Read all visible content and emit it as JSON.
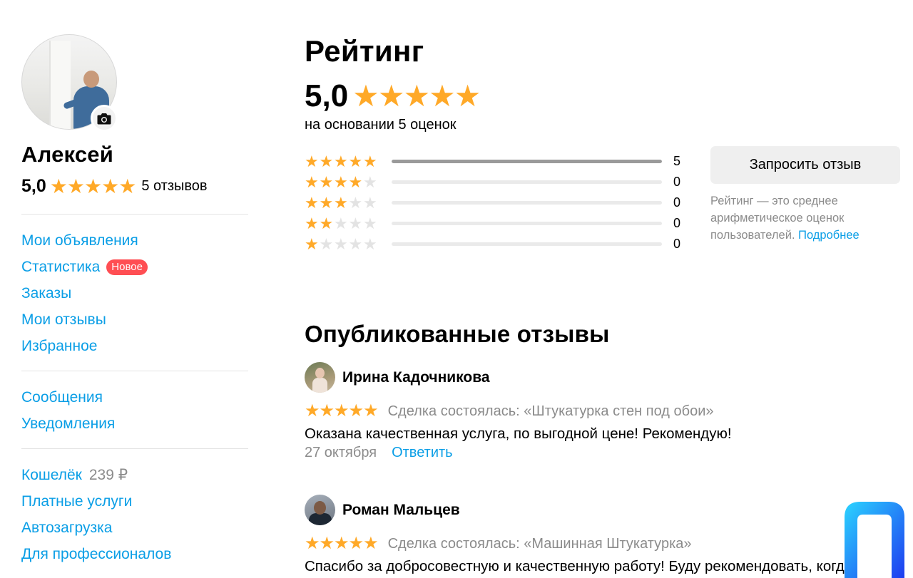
{
  "profile": {
    "name": "Алексей",
    "rating": "5,0",
    "reviews_count": "5 отзывов"
  },
  "sidebar": {
    "group1": [
      {
        "label": "Мои объявления"
      },
      {
        "label": "Статистика",
        "badge": "Новое"
      },
      {
        "label": "Заказы"
      },
      {
        "label": "Мои отзывы"
      },
      {
        "label": "Избранное"
      }
    ],
    "group2": [
      {
        "label": "Сообщения"
      },
      {
        "label": "Уведомления"
      }
    ],
    "group3": [
      {
        "label": "Кошелёк",
        "amount": "239 ₽"
      },
      {
        "label": "Платные услуги"
      },
      {
        "label": "Автозагрузка"
      },
      {
        "label": "Для профессионалов"
      }
    ]
  },
  "rating": {
    "title": "Рейтинг",
    "score": "5,0",
    "basis": "на основании 5 оценок",
    "breakdown": [
      {
        "stars": 5,
        "count": "5",
        "fraction": 1.0
      },
      {
        "stars": 4,
        "count": "0",
        "fraction": 0
      },
      {
        "stars": 3,
        "count": "0",
        "fraction": 0
      },
      {
        "stars": 2,
        "count": "0",
        "fraction": 0
      },
      {
        "stars": 1,
        "count": "0",
        "fraction": 0
      }
    ],
    "request_button": "Запросить отзыв",
    "note": "Рейтинг — это среднее арифметическое оценок пользователей.",
    "note_link": "Подробнее"
  },
  "reviews": {
    "title": "Опубликованные отзывы",
    "items": [
      {
        "author": "Ирина Кадочникова",
        "stars": 5,
        "deal": "Сделка состоялась: «Штукатурка стен под обои»",
        "text": "Оказана качественная услуга, по выгодной цене! Рекомендую!",
        "date": "27 октября",
        "reply": "Ответить"
      },
      {
        "author": "Роман Мальцев",
        "stars": 5,
        "deal": "Сделка состоялась: «Машинная Штукатурка»",
        "text": "Спасибо за добросовестную и качественную работу! Буду рекомендовать, когда кому то понадобиться!",
        "date": "",
        "reply": ""
      }
    ]
  },
  "colors": {
    "accent": "#0a9ee6",
    "star": "#ffa928",
    "star_empty": "#e3e3e3",
    "badge": "#ff4e53",
    "muted": "#8b8b8b"
  },
  "icons": {
    "camera": "camera-icon",
    "star": "star-icon"
  }
}
